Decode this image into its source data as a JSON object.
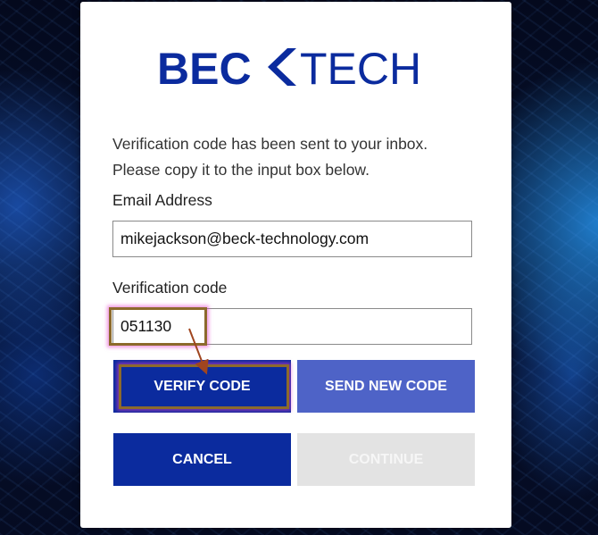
{
  "brand": {
    "logo_text_bold": "BEC",
    "logo_text_light": "TECH",
    "logo_color": "#0b2b9e"
  },
  "form": {
    "message_line1": "Verification code has been sent to your inbox.",
    "message_line2": "Please copy it to the input box below.",
    "email_label": "Email Address",
    "email_value": "mikejackson@beck-technology.com",
    "code_label": "Verification code",
    "code_value": "051130"
  },
  "buttons": {
    "verify": "VERIFY CODE",
    "send_new": "SEND NEW CODE",
    "cancel": "CANCEL",
    "continue": "CONTINUE"
  },
  "colors": {
    "primary": "#0b2b9e",
    "secondary": "#4e63c7",
    "disabled": "#e3e3e3",
    "annotation": "#8c6a2c"
  },
  "icons": {
    "logo_chevron": "left-chevron-icon"
  }
}
